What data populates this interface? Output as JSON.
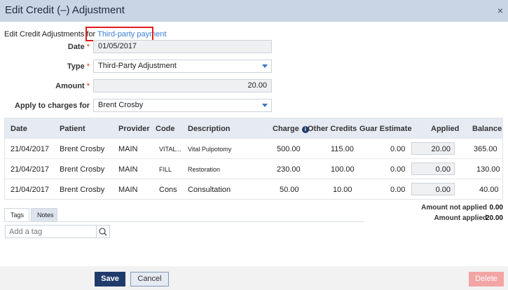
{
  "dialog": {
    "title": "Edit Credit (–) Adjustment",
    "close_glyph": "×"
  },
  "for_line": {
    "prefix": "Edit Credit Adjustments for",
    "link": "Third-party payment"
  },
  "form": {
    "date": {
      "label": "Date",
      "required": "*",
      "value": "01/05/2017"
    },
    "type": {
      "label": "Type",
      "required": "*",
      "value": "Third-Party Adjustment"
    },
    "amount": {
      "label": "Amount",
      "required": "*",
      "value": "20.00"
    },
    "apply_to": {
      "label": "Apply to charges for",
      "value": "Brent Crosby"
    }
  },
  "grid": {
    "headers": {
      "date": "Date",
      "patient": "Patient",
      "provider": "Provider",
      "code": "Code",
      "description": "Description",
      "charge": "Charge",
      "other_credits": "Other Credits",
      "guar_estimate": "Guar Estimate",
      "applied": "Applied",
      "balance": "Balance"
    },
    "rows": [
      {
        "date": "21/04/2017",
        "patient": "Brent Crosby",
        "provider": "MAIN",
        "code": "VITAL...",
        "description": "Vital Pulpotomy",
        "charge": "500.00",
        "other_credits": "115.00",
        "guar_estimate": "0.00",
        "applied": "20.00",
        "balance": "365.00"
      },
      {
        "date": "21/04/2017",
        "patient": "Brent Crosby",
        "provider": "MAIN",
        "code": "FILL",
        "description": "Restoration",
        "charge": "230.00",
        "other_credits": "100.00",
        "guar_estimate": "0.00",
        "applied": "0.00",
        "balance": "130.00"
      },
      {
        "date": "21/04/2017",
        "patient": "Brent Crosby",
        "provider": "MAIN",
        "code": "Cons",
        "description": "Consultation",
        "charge": "50.00",
        "other_credits": "10.00",
        "guar_estimate": "0.00",
        "applied": "0.00",
        "balance": "40.00"
      }
    ]
  },
  "tabs": {
    "tags": "Tags",
    "notes": "Notes"
  },
  "tag_input": {
    "placeholder": "Add a tag"
  },
  "summary": {
    "not_applied_label": "Amount not applied",
    "not_applied_value": "0.00",
    "applied_label": "Amount applied",
    "applied_value": "20.00"
  },
  "buttons": {
    "save": "Save",
    "cancel": "Cancel",
    "delete": "Delete"
  },
  "colors": {
    "title_bar": "#c9d4e5",
    "primary": "#1f3b6b",
    "link": "#3a7fd5",
    "highlight": "#e21c1c",
    "delete": "#f3a5a5"
  },
  "icons": {
    "close": "close-icon",
    "info": "info-icon",
    "search": "search-icon",
    "dropdown": "chevron-down-icon"
  }
}
